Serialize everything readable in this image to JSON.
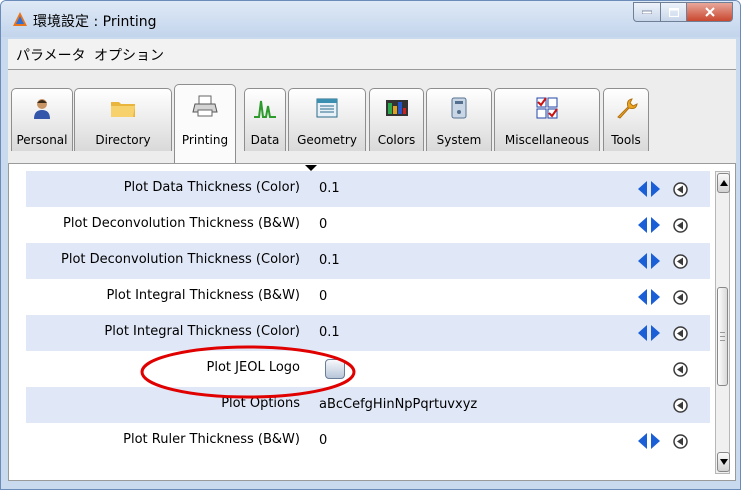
{
  "window": {
    "title": "環境設定 : Printing"
  },
  "menu": {
    "items": [
      "パラメータ",
      "オプション"
    ]
  },
  "tabs": [
    {
      "label": "Personal",
      "icon": "person-icon"
    },
    {
      "label": "Directory",
      "icon": "folder-icon"
    },
    {
      "label": "Printing",
      "icon": "printer-icon",
      "active": true
    },
    {
      "label": "Data",
      "icon": "spectrum-icon"
    },
    {
      "label": "Geometry",
      "icon": "window-icon"
    },
    {
      "label": "Colors",
      "icon": "colors-icon"
    },
    {
      "label": "System",
      "icon": "system-icon"
    },
    {
      "label": "Miscellaneous",
      "icon": "checkbox-grid-icon"
    },
    {
      "label": "Tools",
      "icon": "wrench-icon"
    }
  ],
  "settings": [
    {
      "label": "Plot Data Thickness (Color)",
      "value": "0.1",
      "spinner": true
    },
    {
      "label": "Plot Deconvolution Thickness (B&W)",
      "value": "0",
      "spinner": true
    },
    {
      "label": "Plot Deconvolution Thickness (Color)",
      "value": "0.1",
      "spinner": true
    },
    {
      "label": "Plot Integral Thickness (B&W)",
      "value": "0",
      "spinner": true
    },
    {
      "label": "Plot Integral Thickness (Color)",
      "value": "0.1",
      "spinner": true
    },
    {
      "label": "Plot JEOL Logo",
      "value": "",
      "checkbox": true,
      "checked": false
    },
    {
      "label": "Plot Options",
      "value": "aBcCefgHinNpPqrtuvxyz",
      "spinner": false
    },
    {
      "label": "Plot Ruler Thickness (B&W)",
      "value": "0",
      "spinner": true
    }
  ],
  "colors": {
    "accent": "#1a5fd6",
    "highlight_row": "#e0e7f7",
    "annotation": "#e00000"
  }
}
